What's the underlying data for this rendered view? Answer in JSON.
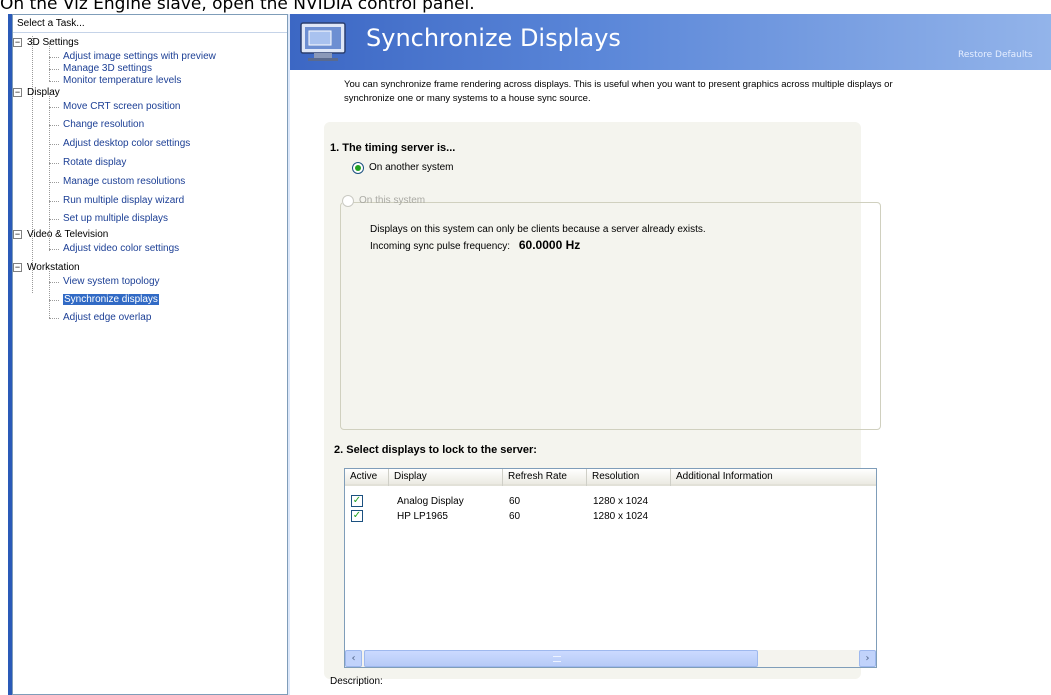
{
  "caption": "On the Viz Engine slave, open the NVIDIA control panel.",
  "taskpane": {
    "header": "Select a Task...",
    "categories": [
      {
        "label": "3D Settings",
        "items": [
          "Adjust image settings with preview",
          "Manage 3D settings",
          "Monitor temperature levels"
        ]
      },
      {
        "label": "Display",
        "items": [
          "Move CRT screen position",
          "Change resolution",
          "Adjust desktop color settings",
          "Rotate display",
          "Manage custom resolutions",
          "Run multiple display wizard",
          "Set up multiple displays"
        ]
      },
      {
        "label": "Video & Television",
        "items": [
          "Adjust video color settings"
        ]
      },
      {
        "label": "Workstation",
        "items": [
          "View system topology",
          "Synchronize displays",
          "Adjust edge overlap"
        ]
      }
    ],
    "expander_glyph": "−",
    "selected": "Synchronize displays"
  },
  "main": {
    "title": "Synchronize Displays",
    "restore_defaults": "Restore Defaults",
    "intro_line1": "You can synchronize frame rendering across displays. This is useful when you want to present graphics across multiple displays or",
    "intro_line2": "synchronize one or many systems to a house sync source.",
    "timing": {
      "heading": "1. The timing server is...",
      "option_other": "On another system",
      "option_this": "On this system",
      "selected": "On another system",
      "info_clients": "Displays on this system can only be clients because a server already exists.",
      "freq_label": "Incoming sync pulse frequency:",
      "freq_value": "60.0000 Hz"
    },
    "displays": {
      "heading": "2. Select displays to lock to the server:",
      "columns": [
        "Active",
        "Display",
        "Refresh Rate",
        "Resolution",
        "Additional Information"
      ],
      "rows": [
        {
          "active": true,
          "display": "Analog Display",
          "refresh": "60",
          "resolution": "1280 x 1024",
          "info": ""
        },
        {
          "active": true,
          "display": "HP LP1965",
          "refresh": "60",
          "resolution": "1280 x 1024",
          "info": ""
        }
      ],
      "scroll_left": "‹",
      "scroll_right": "›"
    },
    "description_label": "Description:"
  }
}
